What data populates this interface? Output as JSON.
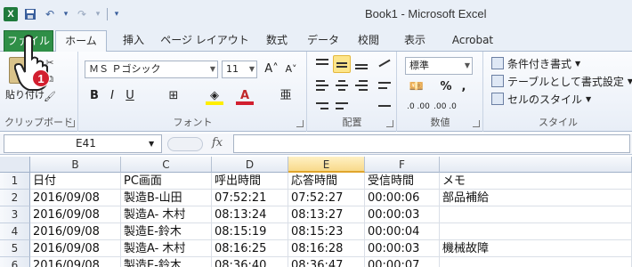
{
  "window": {
    "title": "Book1 - Microsoft Excel",
    "app_icon": "X"
  },
  "qat": {
    "undo_glyph": "↶",
    "redo_glyph": "↷",
    "dropdown_glyph": "▾"
  },
  "tabs": [
    {
      "label": "ファイル"
    },
    {
      "label": "ホーム"
    },
    {
      "label": "挿入"
    },
    {
      "label": "ページ レイアウト"
    },
    {
      "label": "数式"
    },
    {
      "label": "データ"
    },
    {
      "label": "校閲"
    },
    {
      "label": "表示"
    },
    {
      "label": "Acrobat"
    }
  ],
  "ribbon": {
    "clipboard": {
      "label": "クリップボード",
      "paste_label": "貼り付け"
    },
    "font": {
      "label": "フォント",
      "font_name": "ＭＳ Ｐゴシック",
      "font_size": "11",
      "grow": "A˄",
      "shrink": "A˅",
      "bold": "B",
      "italic": "I",
      "underline": "U",
      "color_a": "A",
      "phonetic": "亜"
    },
    "alignment": {
      "label": "配置"
    },
    "number": {
      "label": "数値",
      "format": "標準",
      "percent": "%",
      "comma": ","
    },
    "styles": {
      "label": "スタイル",
      "conditional": "条件付き書式",
      "table": "テーブルとして書式設定",
      "cell": "セルのスタイル"
    }
  },
  "formula_bar": {
    "name_box": "E41",
    "fx": "fx",
    "formula": ""
  },
  "annotation": {
    "badge": "1"
  },
  "accent": {
    "file_tab": "#2f8f47",
    "badge": "#d21f2f",
    "selected_col": "#f8d98a"
  },
  "grid": {
    "columns": [
      "B",
      "C",
      "D",
      "E",
      "F"
    ],
    "selected_column": "E",
    "rows": [
      {
        "num": "1",
        "cells": [
          "日付",
          "PC画面",
          "呼出時間",
          "応答時間",
          "受信時間",
          "メモ"
        ]
      },
      {
        "num": "2",
        "cells": [
          "2016/09/08",
          "製造B-山田",
          "07:52:21",
          "07:52:27",
          "00:00:06",
          "部品補給"
        ]
      },
      {
        "num": "3",
        "cells": [
          "2016/09/08",
          "製造A- 木村",
          "08:13:24",
          "08:13:27",
          "00:00:03",
          ""
        ]
      },
      {
        "num": "4",
        "cells": [
          "2016/09/08",
          "製造E-鈴木",
          "08:15:19",
          "08:15:23",
          "00:00:04",
          ""
        ]
      },
      {
        "num": "5",
        "cells": [
          "2016/09/08",
          "製造A- 木村",
          "08:16:25",
          "08:16:28",
          "00:00:03",
          "機械故障"
        ]
      },
      {
        "num": "6",
        "cells": [
          "2016/09/08",
          "製造E-鈴木",
          "08:36:40",
          "08:36:47",
          "00:00:07",
          ""
        ]
      }
    ]
  }
}
